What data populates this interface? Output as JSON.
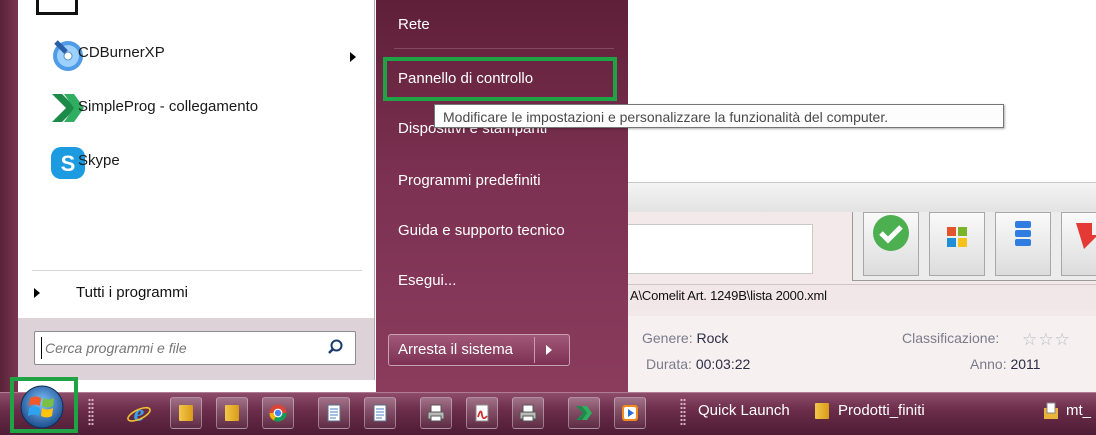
{
  "start_menu": {
    "programs": [
      {
        "label": "CDBurnerXP",
        "icon": "cdburnerxp-icon",
        "has_submenu": true
      },
      {
        "label": "SimpleProg - collegamento",
        "icon": "simpleprog-icon",
        "has_submenu": false
      },
      {
        "label": "Skype",
        "icon": "skype-icon",
        "has_submenu": false
      }
    ],
    "all_programs": "Tutti i programmi",
    "search_placeholder": "Cerca programmi e file",
    "right_links": [
      {
        "label": "Rete"
      },
      {
        "label": "Pannello di controllo"
      },
      {
        "label": "Dispositivi e stampanti"
      },
      {
        "label": "Programmi predefiniti"
      },
      {
        "label": "Guida e supporto tecnico"
      },
      {
        "label": "Esegui..."
      }
    ],
    "shutdown_label": "Arresta il sistema",
    "tooltip": "Modificare le impostazioni e personalizzare la funzionalità del computer."
  },
  "background_app": {
    "path": "A\\Comelit Art. 1249B\\lista 2000.xml",
    "genre_label": "Genere:",
    "genre_value": "Rock",
    "duration_label": "Durata:",
    "duration_value": "00:03:22",
    "rating_label": "Classificazione:",
    "year_label": "Anno:",
    "year_value": "2011"
  },
  "taskbar": {
    "quick_launch": "Quick Launch",
    "folder_label": "Prodotti_finiti",
    "trailing_label": "mt_",
    "buttons": [
      "internet-explorer-icon",
      "folder-icon",
      "folder-icon",
      "chrome-icon",
      "notepad-icon",
      "notepad-icon",
      "printer-icon",
      "pdf-icon",
      "notepad-icon",
      "printer-icon",
      "simpleprog-icon",
      "media-player-icon"
    ]
  },
  "colors": {
    "accent_highlight": "#1fa345",
    "start_menu_right": "#7c3152",
    "taskbar": "#6b2d4a"
  }
}
